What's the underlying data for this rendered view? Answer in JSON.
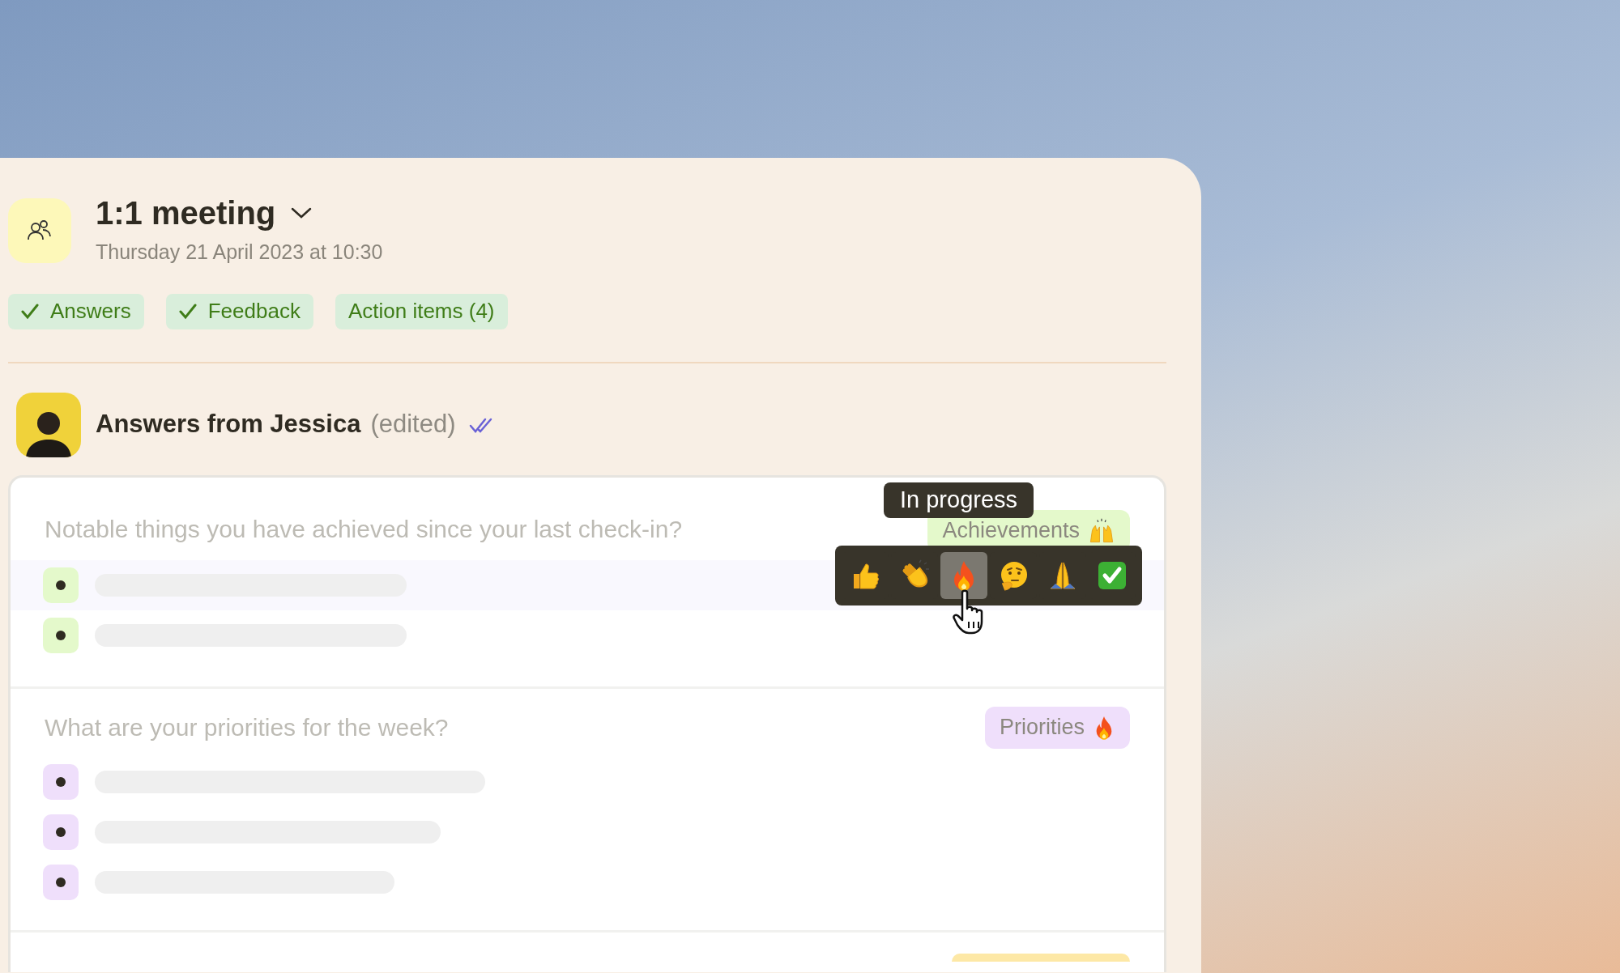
{
  "meeting": {
    "title": "1:1 meeting",
    "date": "Thursday 21 April 2023 at 10:30"
  },
  "chips": [
    {
      "label": "Answers",
      "done": true
    },
    {
      "label": "Feedback",
      "done": true
    },
    {
      "label": "Action items (4)",
      "done": false
    }
  ],
  "answers": {
    "title": "Answers from Jessica",
    "note": "(edited)",
    "seen": true
  },
  "questions": [
    {
      "text": "Notable things you have achieved since your last check-in?",
      "tag": {
        "label": "Achievements",
        "color": "#e4f9cb"
      },
      "items": [
        {
          "hovered": true
        },
        {
          "hovered": false
        }
      ]
    },
    {
      "text": "What are your priorities for the week?",
      "tag": {
        "label": "Priorities",
        "color": "#efdffb"
      },
      "items": [
        {
          "hovered": false
        },
        {
          "hovered": false
        },
        {
          "hovered": false
        }
      ]
    },
    {
      "tag": {
        "color": "#fde8a6"
      }
    }
  ],
  "reactions": {
    "tooltip": "In progress",
    "items": [
      {
        "kind": "thumbs-up",
        "hovered": false
      },
      {
        "kind": "clap",
        "hovered": false
      },
      {
        "kind": "fire",
        "hovered": true
      },
      {
        "kind": "thinking",
        "hovered": false
      },
      {
        "kind": "pray",
        "hovered": false
      },
      {
        "kind": "check",
        "hovered": false
      }
    ]
  }
}
